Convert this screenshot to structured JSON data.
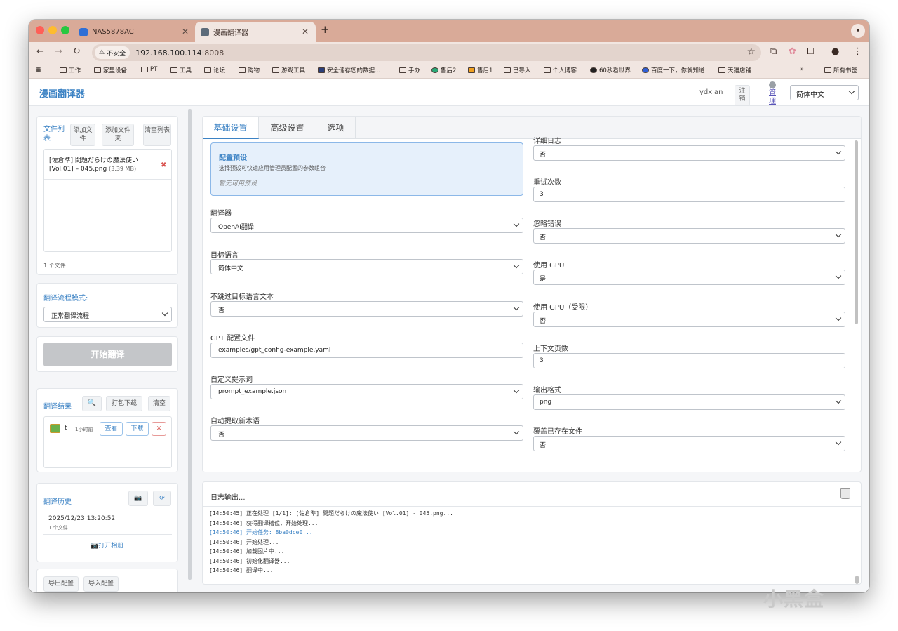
{
  "browser": {
    "tabs": [
      {
        "title": "NAS5878AC",
        "active": false
      },
      {
        "title": "漫画翻译器",
        "active": true
      }
    ],
    "security_label": "不安全",
    "url_host": "192.168.100.114",
    "url_port": ":8008",
    "bookmarks": [
      "工作",
      "家里设备",
      "PT",
      "工具",
      "论坛",
      "购物",
      "游戏工具",
      "安全储存您的数据...",
      "手办",
      "售后2",
      "售后1",
      "已导入",
      "个人博客",
      "60秒看世界",
      "百度一下，你就知道",
      "天猫店铺"
    ],
    "bookmarks_more": "»",
    "all_bookmarks": "所有书签"
  },
  "header": {
    "title": "漫画翻译器",
    "username": "ydxian",
    "logout_label": "注\n销",
    "admin_label": "管\n理",
    "language": "简体中文"
  },
  "sidebar": {
    "file_list_label": "文件列表",
    "add_file": "添加文件",
    "add_folder": "添加文件夹",
    "clear_list": "清空列表",
    "files": [
      {
        "name": "[佐倉準] 問題だらけの魔法使い [Vol.01] – 045.png",
        "size": "(3.39 MB)"
      }
    ],
    "file_count": "1 个文件",
    "workflow_label": "翻译流程模式:",
    "workflow_value": "正常翻译流程",
    "start_button": "开始翻译",
    "results_label": "翻译结果",
    "pack_download": "打包下载",
    "clear_results": "清空",
    "result_item": {
      "name": "t",
      "time": "1小时前",
      "view": "查看",
      "download": "下载"
    },
    "history_label": "翻译历史",
    "history_item": {
      "date": "2025/12/23 13:20:52",
      "count": "1 个文件"
    },
    "open_album": "打开相册",
    "export_config": "导出配置",
    "import_config": "导入配置"
  },
  "settings": {
    "tabs": [
      "基础设置",
      "高级设置",
      "选项"
    ],
    "preset": {
      "title": "配置预设",
      "desc": "选择预设可快速应用管理员配置的参数组合",
      "empty": "暂无可用预设"
    },
    "left_fields": [
      {
        "label": "翻译器",
        "value": "OpenAI翻译",
        "type": "select"
      },
      {
        "label": "目标语言",
        "value": "简体中文",
        "type": "select"
      },
      {
        "label": "不跳过目标语言文本",
        "value": "否",
        "type": "select"
      },
      {
        "label": "GPT 配置文件",
        "value": "examples/gpt_config-example.yaml",
        "type": "input"
      },
      {
        "label": "自定义提示词",
        "value": "prompt_example.json",
        "type": "select"
      },
      {
        "label": "自动提取新术语",
        "value": "否",
        "type": "select"
      }
    ],
    "right_fields": [
      {
        "label": "详细日志",
        "value": "否",
        "type": "select"
      },
      {
        "label": "重试次数",
        "value": "3",
        "type": "input"
      },
      {
        "label": "忽略错误",
        "value": "否",
        "type": "select"
      },
      {
        "label": "使用 GPU",
        "value": "是",
        "type": "select"
      },
      {
        "label": "使用 GPU（受限）",
        "value": "否",
        "type": "select"
      },
      {
        "label": "上下文页数",
        "value": "3",
        "type": "input"
      },
      {
        "label": "输出格式",
        "value": "png",
        "type": "select"
      },
      {
        "label": "覆盖已存在文件",
        "value": "否",
        "type": "select"
      }
    ]
  },
  "log": {
    "title": "日志输出...",
    "lines": [
      {
        "text": "[14:50:45] 正在处理 [1/1]: [佐倉準] 問題だらけの魔法使い [Vol.01] - 045.png...",
        "highlight": false
      },
      {
        "text": "[14:50:46] 获得翻译槽位，开始处理...",
        "highlight": false
      },
      {
        "text": "[14:50:46] 开始任务: 8ba0dce0...",
        "highlight": true
      },
      {
        "text": "[14:50:46] 开始处理...",
        "highlight": false
      },
      {
        "text": "[14:50:46] 加载图片中...",
        "highlight": false
      },
      {
        "text": "[14:50:46] 初始化翻译器...",
        "highlight": false
      },
      {
        "text": "[14:50:46] 翻译中...",
        "highlight": false
      }
    ]
  },
  "watermark": "小黑盒",
  "colors": {
    "accent": "#3b82c4",
    "tabstrip": "#d9aa98",
    "danger": "#d9534f"
  }
}
